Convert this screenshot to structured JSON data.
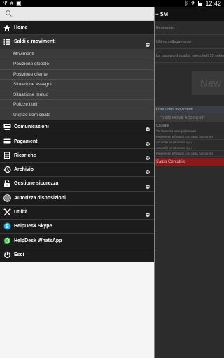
{
  "status_bar": {
    "left_icons": [
      "usb-icon",
      "hash-icon",
      "briefcase-icon"
    ],
    "right_icons": [
      "bluetooth-icon",
      "airplane-icon",
      "battery-icon"
    ],
    "time": "12:42"
  },
  "drawer": {
    "search": {
      "value": "",
      "placeholder": ""
    },
    "items": [
      {
        "label": "Home",
        "icon": "home-icon"
      },
      {
        "label": "Saldi e movimenti",
        "icon": "list-icon",
        "expanded": true,
        "subitems": [
          "Movimenti",
          "Posizione globale",
          "Posizione cliente",
          "Situazione assegni",
          "Situazione mutuo",
          "Polizze titoli",
          "Utenze domiciliate"
        ]
      },
      {
        "label": "Comunicazioni",
        "icon": "keyboard-icon"
      },
      {
        "label": "Pagamenti",
        "icon": "card-icon"
      },
      {
        "label": "Ricariche",
        "icon": "calculator-icon"
      },
      {
        "label": "Archivio",
        "icon": "history-icon"
      },
      {
        "label": "Gestione sicurezza",
        "icon": "lock-icon"
      },
      {
        "label": "Autorizza disposizioni",
        "icon": "stack-icon"
      },
      {
        "label": "Utilità",
        "icon": "tools-icon"
      },
      {
        "label": "HelpDesk Skype",
        "icon": "skype-icon"
      },
      {
        "label": "HelpDesk WhatsApp",
        "icon": "whatsapp-icon"
      },
      {
        "label": "Esci",
        "icon": "power-icon"
      }
    ]
  },
  "background_app": {
    "rows": [
      "Benvenuto",
      "Ultimo collegamento",
      "La password scadrà mercoledì 10 settembre"
    ],
    "banner_text": "New",
    "section_title": "Lista ultimi movimenti",
    "account": "**2982 HOME ACCOUNT",
    "small_label": "Causale",
    "lines": [
      "Versamento assegni bancari",
      "Pagamenti effettuati con carta bancomat",
      "Accrediti emolumenti s.p.r.",
      "Accrediti emolumenti s.p.r.",
      "Pagamenti effettuati con carta bancomat"
    ],
    "saldo": "Saldo Contabile"
  }
}
